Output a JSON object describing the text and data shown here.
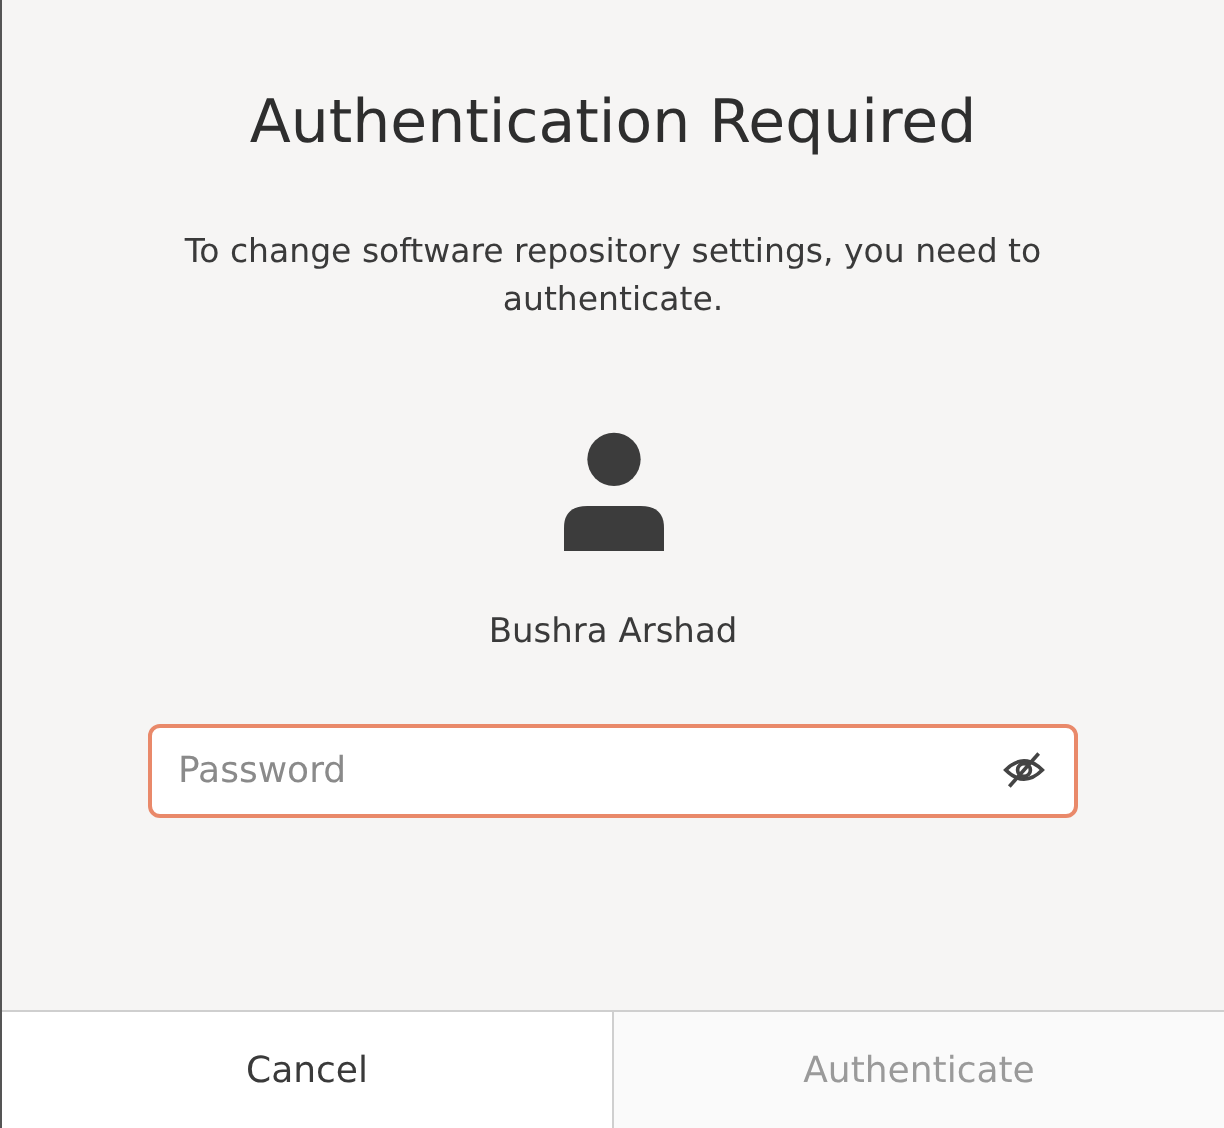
{
  "dialog": {
    "title": "Authentication Required",
    "message": "To change software repository settings, you need to authenticate."
  },
  "user": {
    "name": "Bushra Arshad"
  },
  "password_field": {
    "placeholder": "Password",
    "focused": true
  },
  "buttons": [
    {
      "label": "Cancel",
      "disabled": false
    },
    {
      "label": "Authenticate",
      "disabled": true
    }
  ]
}
